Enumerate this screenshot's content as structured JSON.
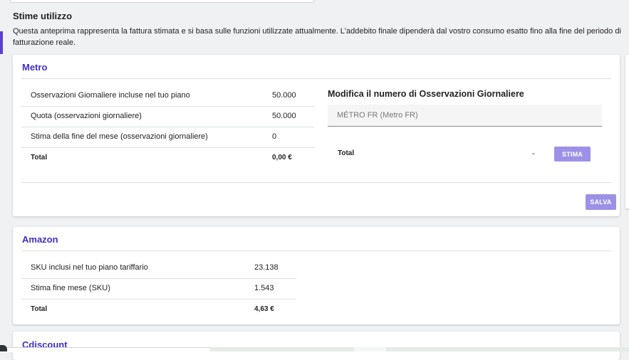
{
  "page": {
    "title": "Stime utilizzo",
    "description": "Questa anteprima rappresenta la fattura stimata e si basa sulle funzioni utilizzate attualmente. L'addebito finale dipenderà dal vostro consumo esatto fino alla fine del periodo di fatturazione reale."
  },
  "metro": {
    "title": "Metro",
    "rows": [
      {
        "label": "Osservazioni Giornaliere incluse nel tuo piano",
        "value": "50.000"
      },
      {
        "label": "Quota (osservazioni giornaliere)",
        "value": "50.000"
      },
      {
        "label": "Stima della fine del mese (osservazioni giornaliere)",
        "value": "0"
      },
      {
        "label": "Total",
        "value": "0,00 €"
      }
    ],
    "modify_title": "Modifica il numero di Osservazioni Giornaliere",
    "select_value": "MÉTRO FR (Metro FR)",
    "total_label": "Total",
    "total_value": "-",
    "estimate_button": "STIMA",
    "save_button": "SALVA"
  },
  "amazon": {
    "title": "Amazon",
    "rows": [
      {
        "label": "SKU inclusi nel tuo piano tariffario",
        "value": "23.138"
      },
      {
        "label": "Stima fine mese (SKU)",
        "value": "1.543"
      },
      {
        "label": "Total",
        "value": "4,63 €"
      }
    ]
  },
  "cdiscount": {
    "title": "Cdiscount"
  },
  "colors": {
    "accent": "#3f2fc9",
    "button": "#9c91e6",
    "background": "#f0f1f3"
  }
}
